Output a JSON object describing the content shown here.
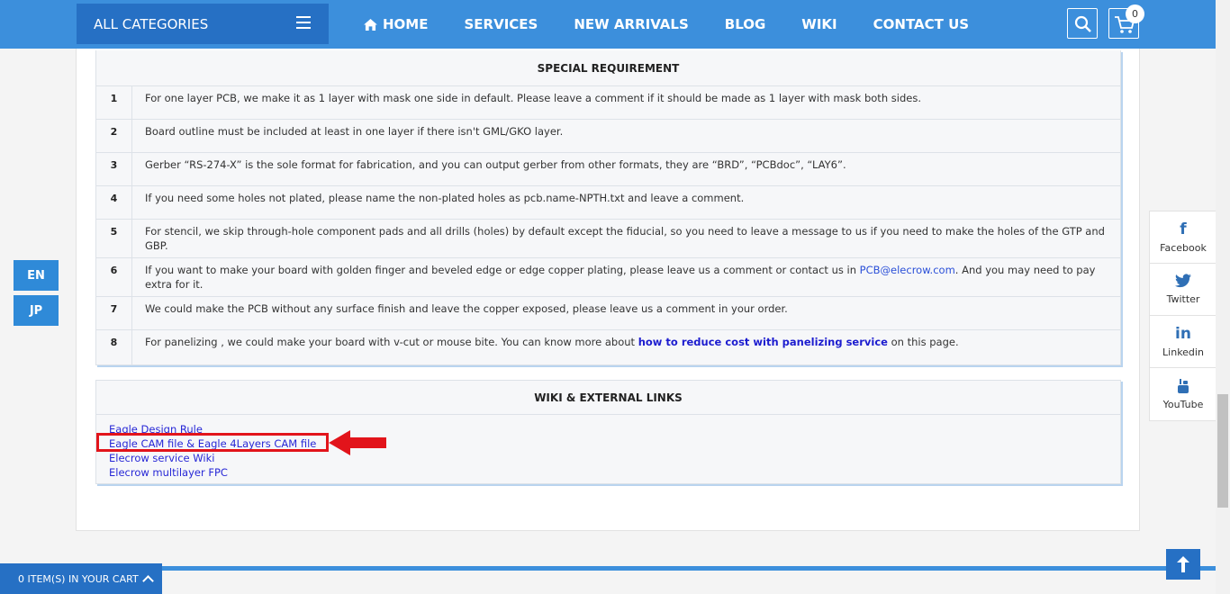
{
  "header": {
    "all_categories": "ALL CATEGORIES",
    "nav": [
      "HOME",
      "SERVICES",
      "NEW ARRIVALS",
      "BLOG",
      "WIKI",
      "CONTACT US"
    ],
    "cart_count": "0"
  },
  "language": [
    "EN",
    "JP"
  ],
  "special_requirement": {
    "title": "SPECIAL REQUIREMENT",
    "rows": [
      {
        "num": "1",
        "text": "For one layer PCB, we make it as 1 layer with mask one side in default. Please leave a comment if it should be made as 1 layer with mask both sides."
      },
      {
        "num": "2",
        "text": "Board outline must be included at least in one layer if there isn't GML/GKO layer."
      },
      {
        "num": "3",
        "text": "Gerber “RS-274-X” is the sole format for fabrication, and you can output gerber from other formats, they are “BRD”, “PCBdoc”, “LAY6”."
      },
      {
        "num": "4",
        "text": "If you need some holes not plated, please name the non-plated holes as pcb.name-NPTH.txt and leave a comment."
      },
      {
        "num": "5",
        "text": "For stencil, we skip through-hole component pads and all drills (holes) by default except the fiducial, so you need to leave a message to us if you need to make the holes of the GTP and GBP."
      },
      {
        "num": "6",
        "text_before": "If you want to make your board with golden finger and beveled edge or edge copper plating, please leave us a comment or contact us in ",
        "link": "PCB@elecrow.com",
        "text_after": ". And you may need to pay extra for it."
      },
      {
        "num": "7",
        "text": "We could make the PCB without any surface finish and leave the copper exposed, please leave us a comment in your order."
      },
      {
        "num": "8",
        "text_before": "For panelizing , we could make your board with v-cut or mouse bite. You can know more about ",
        "link": "how to reduce cost with panelizing service",
        "text_after": " on this page."
      }
    ]
  },
  "wiki_links": {
    "title": "WIKI & EXTERNAL LINKS",
    "links": [
      "Eagle Design Rule",
      "Eagle CAM file & Eagle 4Layers CAM file",
      "Elecrow service Wiki",
      "Elecrow multilayer FPC"
    ]
  },
  "social": [
    {
      "label": "Facebook",
      "icon": "f"
    },
    {
      "label": "Twitter",
      "icon": "twitter-bird"
    },
    {
      "label": "Linkedin",
      "icon": "in"
    },
    {
      "label": "YouTube",
      "icon": "youtube"
    }
  ],
  "cart_bar": {
    "label": "0 ITEM(S) IN YOUR CART"
  },
  "colors": {
    "header": "#3c8fdc",
    "accent": "#2670c4",
    "highlight": "#e2141b"
  }
}
